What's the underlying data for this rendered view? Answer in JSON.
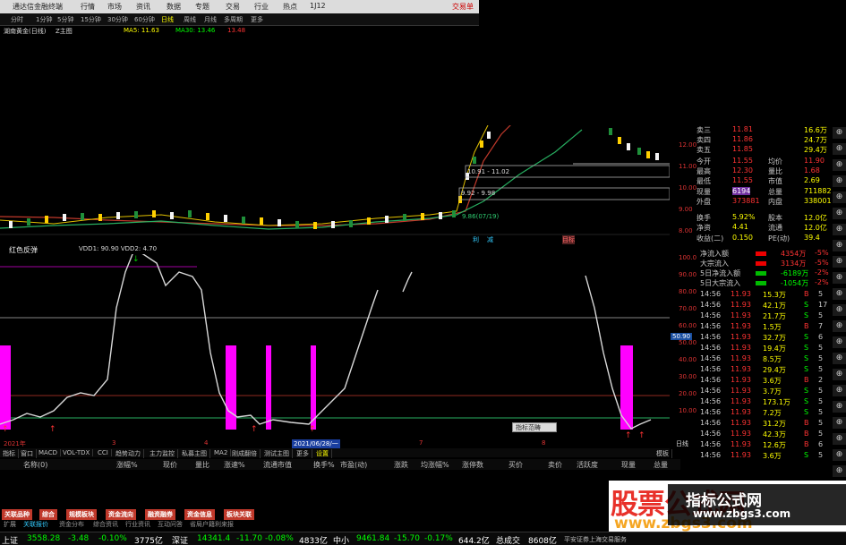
{
  "title_bar": {
    "app": "通达信金融终端",
    "menus": [
      "行情",
      "市场",
      "资讯",
      "数据",
      "专题",
      "交易",
      "行业",
      "热点",
      "1J12"
    ],
    "right": "交易单"
  },
  "toolbar": {
    "periods": [
      "分时",
      "1分钟",
      "5分钟",
      "15分钟",
      "30分钟",
      "60分钟",
      "日线",
      "周线",
      "月线",
      "多周期",
      "更多"
    ]
  },
  "main_chart": {
    "stock_label": "湖南黄金(日线)",
    "indicator": "Z主图",
    "ma5_label": "MA5: 11.63",
    "ma30_label": "MA30: 13.46",
    "ma_extra": "13.48",
    "price_box1": "10.91 - 11.02",
    "price_box2": "9.92 - 9.98",
    "green_label": "9.86(07/19)",
    "markers": [
      "利",
      "减"
    ],
    "y_ticks": [
      "12.00",
      "11.00",
      "10.00",
      "9.00",
      "8.00"
    ],
    "target_label": "目标"
  },
  "sub_chart": {
    "name": "红色反弹",
    "params": "VDD1: 90.90  VDD2: 4.70",
    "y_ticks": [
      "100.0",
      "90.00",
      "80.00",
      "70.00",
      "60.00",
      "50.00",
      "40.00",
      "30.00",
      "20.00",
      "10.00"
    ],
    "highlight": "50.90",
    "date_label": "2021/06/28/一",
    "year_label": "2021年",
    "months": [
      "3",
      "4",
      "5",
      "6",
      "7",
      "8"
    ],
    "popup": "指标范畴",
    "period_btn": "日线"
  },
  "indicator_tabs": [
    "指标",
    "窗口",
    "MACD",
    "VOL-TDX",
    "CCI",
    "趋势动力",
    "主力监控",
    "私募主图",
    "MA2",
    "刚成翻倍",
    "测试主图",
    "更多",
    "设置"
  ],
  "indicator_tab_extra": "模板",
  "column_headers": [
    "名称(0)",
    "涨幅%",
    "现价",
    "量比",
    "涨速%",
    "流通市值",
    "换手%",
    "市盈(动)",
    "涨跌",
    "均涨幅%",
    "涨停数",
    "买价",
    "卖价",
    "活跃度",
    "现量",
    "总量"
  ],
  "quote_panel": {
    "rows": [
      {
        "label": "卖三",
        "price": "11.81",
        "vol": "16.6万"
      },
      {
        "label": "卖四",
        "price": "11.86",
        "vol": "24.7万"
      },
      {
        "label": "卖五",
        "price": "11.85",
        "vol": "29.4万"
      },
      {
        "label": "今开",
        "price": "11.55",
        "k2": "均价",
        "v2": "11.90"
      },
      {
        "label": "最高",
        "price": "12.30",
        "k2": "量比",
        "v2": "1.68"
      },
      {
        "label": "最低",
        "price": "11.55",
        "k2": "市值",
        "v2": "2.69"
      },
      {
        "label": "现量",
        "price": "6194",
        "k2": "总量",
        "v2": "711882"
      },
      {
        "label": "外盘",
        "price": "373881",
        "k2": "内盘",
        "v2": "338001"
      },
      {
        "label": "换手",
        "price": "5.92%",
        "k2": "股本",
        "v2": "12.0亿"
      },
      {
        "label": "净资",
        "price": "4.41",
        "k2": "流通",
        "v2": "12.0亿"
      },
      {
        "label": "收益(二)",
        "price": "0.150",
        "k2": "PE(动)",
        "v2": "39.4"
      }
    ],
    "flows": [
      {
        "label": "净流入额",
        "val": "4354万",
        "pct": "-5%"
      },
      {
        "label": "大宗流入",
        "val": "3134万",
        "pct": "-5%"
      },
      {
        "label": "5日净流入额",
        "val": "-6189万",
        "pct": "-2%"
      },
      {
        "label": "5日大宗流入",
        "val": "-1054万",
        "pct": "-2%"
      }
    ],
    "ticks": [
      {
        "time": "14:56",
        "price": "11.93",
        "vol": "15.3万",
        "bs": "B",
        "n": "5"
      },
      {
        "time": "14:56",
        "price": "11.93",
        "vol": "42.1万",
        "bs": "S",
        "n": "17"
      },
      {
        "time": "14:56",
        "price": "11.93",
        "vol": "21.7万",
        "bs": "S",
        "n": "5"
      },
      {
        "time": "14:56",
        "price": "11.93",
        "vol": "1.5万",
        "bs": "B",
        "n": "7"
      },
      {
        "time": "14:56",
        "price": "11.93",
        "vol": "32.7万",
        "bs": "S",
        "n": "6"
      },
      {
        "time": "14:56",
        "price": "11.93",
        "vol": "19.4万",
        "bs": "S",
        "n": "5"
      },
      {
        "time": "14:56",
        "price": "11.93",
        "vol": "8.5万",
        "bs": "S",
        "n": "5"
      },
      {
        "time": "14:56",
        "price": "11.93",
        "vol": "29.4万",
        "bs": "S",
        "n": "5"
      },
      {
        "time": "14:56",
        "price": "11.93",
        "vol": "3.6万",
        "bs": "B",
        "n": "2"
      },
      {
        "time": "14:56",
        "price": "11.93",
        "vol": "3.7万",
        "bs": "S",
        "n": "5"
      },
      {
        "time": "14:56",
        "price": "11.93",
        "vol": "173.1万",
        "bs": "S",
        "n": "5"
      },
      {
        "time": "14:56",
        "price": "11.93",
        "vol": "7.2万",
        "bs": "S",
        "n": "5"
      },
      {
        "time": "14:56",
        "price": "11.93",
        "vol": "31.2万",
        "bs": "B",
        "n": "5"
      },
      {
        "time": "14:56",
        "price": "11.93",
        "vol": "42.3万",
        "bs": "B",
        "n": "5"
      },
      {
        "time": "14:56",
        "price": "11.93",
        "vol": "12.6万",
        "bs": "B",
        "n": "6"
      },
      {
        "time": "14:56",
        "price": "11.93",
        "vol": "3.6万",
        "bs": "S",
        "n": "5"
      }
    ]
  },
  "bottom_tabs": [
    "关联品种",
    "综合",
    "规模板块",
    "资金流向",
    "融资融券",
    "资金信息",
    "板块关联"
  ],
  "bottom_links": [
    "扩展",
    "关联报价",
    "资金分布",
    "综合资讯",
    "行业资讯",
    "互动问答",
    "省局户籍利来报"
  ],
  "status": {
    "sh": "上证",
    "sh_val": "3558.28",
    "sh_chg": "-3.48",
    "sh_pct": "-0.10%",
    "sh_amt": "3775亿",
    "sz": "深证",
    "sz_val": "14341.4",
    "sz_chg": "-11.70",
    "sz_pct": "-0.08%",
    "sz_amt": "4833亿",
    "zx": "中小",
    "zx_val": "9461.84",
    "zx_chg": "-15.70",
    "zx_pct": "-0.17%",
    "zx_amt": "644.2亿",
    "total": "总成交",
    "total_val": "8608亿",
    "broker": "平安证券上海交易服务"
  },
  "ad": {
    "big": "股票公式网",
    "url": "www.zbgs3.com"
  },
  "watermark": {
    "title": "指标公式网",
    "url": "www.zbgs3.com"
  },
  "chart_data": {
    "type": "line",
    "title": "红色反弹",
    "x": [
      "3",
      "4",
      "5",
      "6",
      "7",
      "8"
    ],
    "series": [
      {
        "name": "VDD1",
        "values": [
          15,
          85,
          75,
          15,
          10,
          90,
          10,
          20
        ]
      },
      {
        "name": "VDD2",
        "values": [
          4.7
        ]
      }
    ],
    "ylim": [
      0,
      100
    ]
  }
}
